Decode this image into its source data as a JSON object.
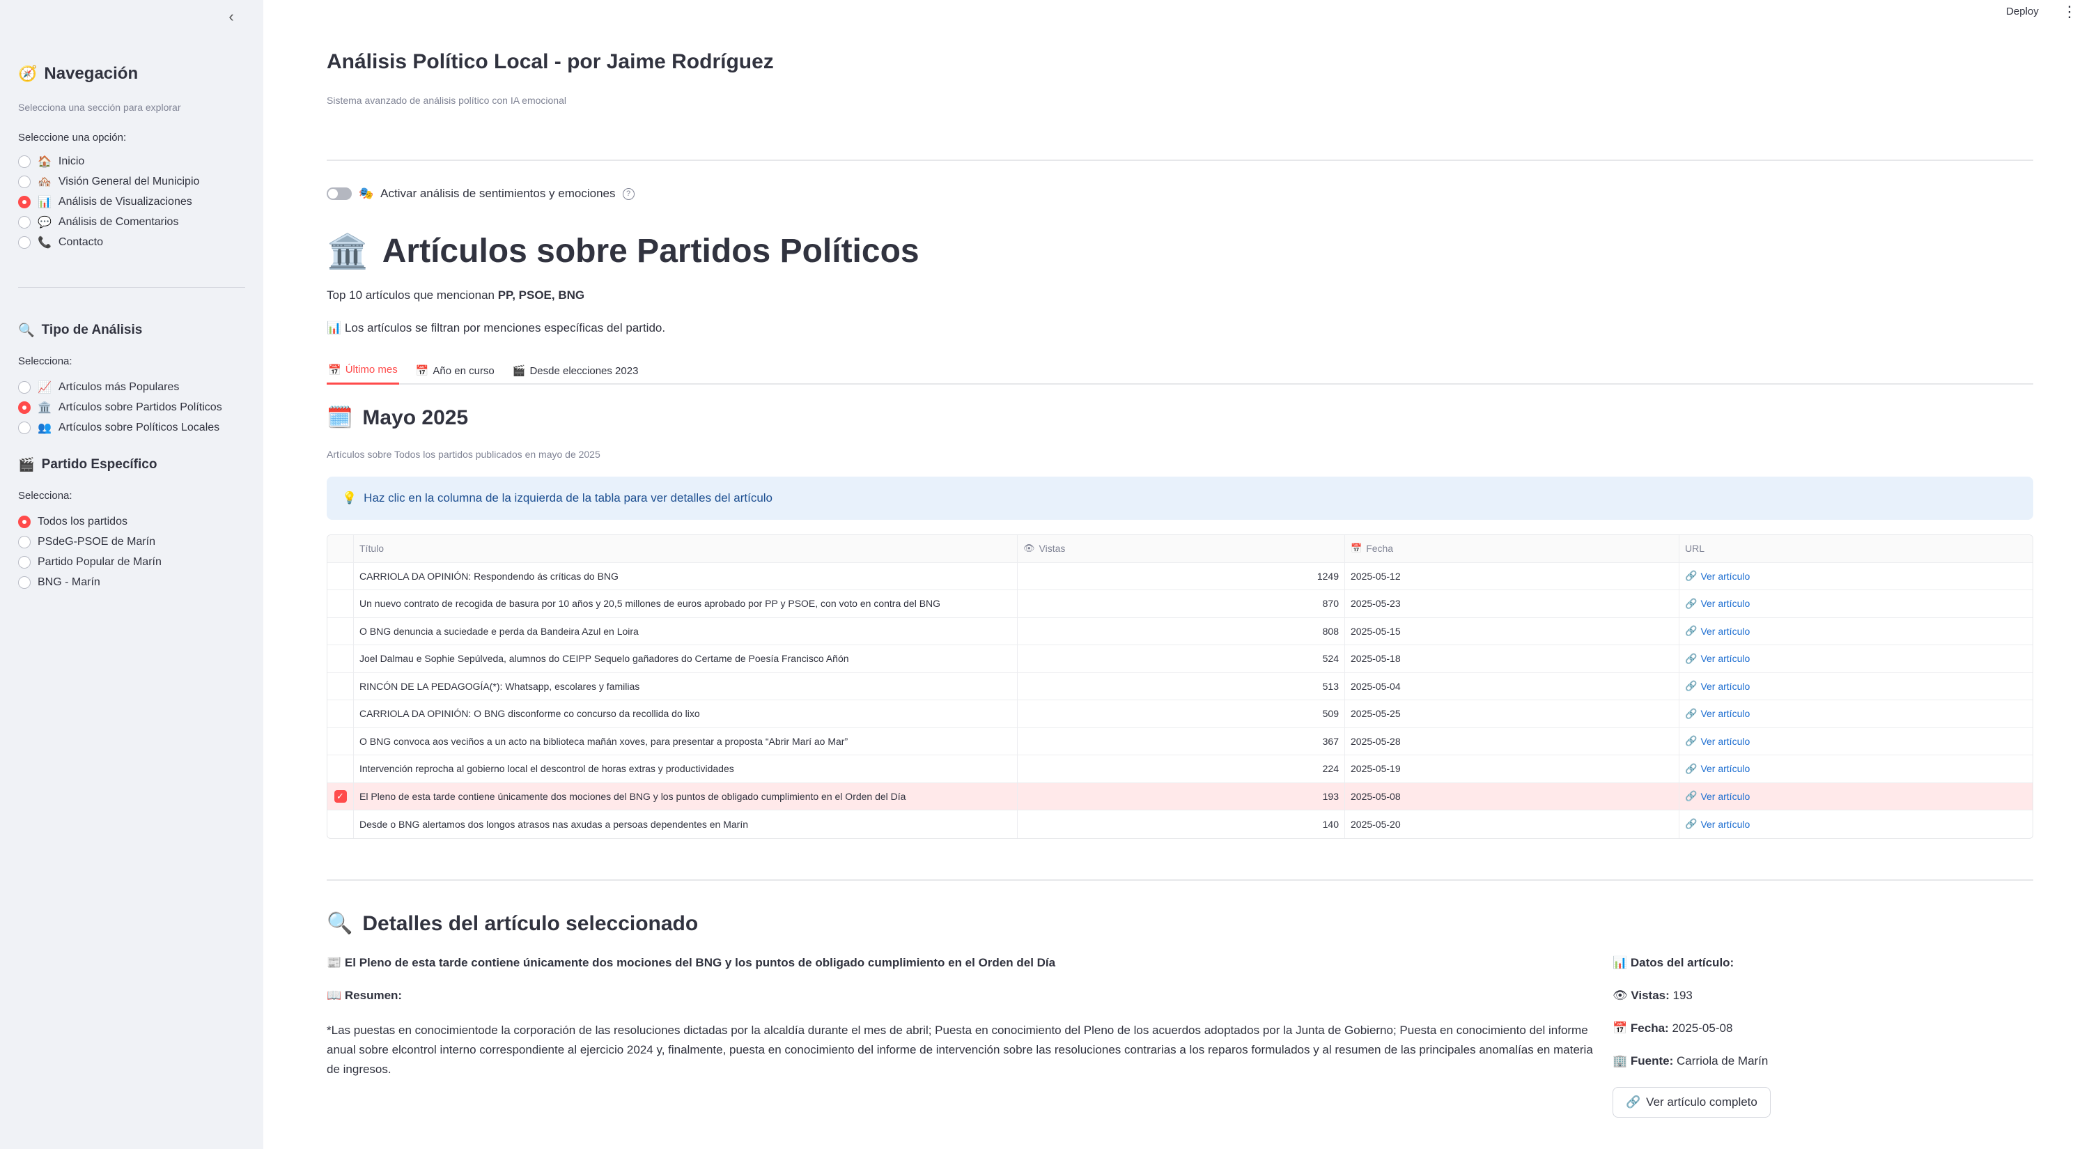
{
  "sidebar": {
    "collapse_icon": "‹",
    "nav": {
      "emoji": "🧭",
      "title": "Navegación",
      "caption": "Selecciona una sección para explorar",
      "label": "Seleccione una opción:",
      "items": [
        {
          "emoji": "🏠",
          "label": "Inicio",
          "selected": false
        },
        {
          "emoji": "🏘️",
          "label": "Visión General del Municipio",
          "selected": false
        },
        {
          "emoji": "📊",
          "label": "Análisis de Visualizaciones",
          "selected": true
        },
        {
          "emoji": "💬",
          "label": "Análisis de Comentarios",
          "selected": false
        },
        {
          "emoji": "📞",
          "label": "Contacto",
          "selected": false
        }
      ]
    },
    "analysis": {
      "emoji": "🔍",
      "title": "Tipo de Análisis",
      "label": "Selecciona:",
      "items": [
        {
          "emoji": "📈",
          "label": "Artículos más Populares",
          "selected": false
        },
        {
          "emoji": "🏛️",
          "label": "Artículos sobre Partidos Políticos",
          "selected": true
        },
        {
          "emoji": "👥",
          "label": "Artículos sobre Políticos Locales",
          "selected": false
        }
      ]
    },
    "party": {
      "emoji": "🎬",
      "title": "Partido Específico",
      "label": "Selecciona:",
      "items": [
        {
          "label": "Todos los partidos",
          "selected": true
        },
        {
          "label": "PSdeG-PSOE de Marín",
          "selected": false
        },
        {
          "label": "Partido Popular de Marín",
          "selected": false
        },
        {
          "label": "BNG - Marín",
          "selected": false
        }
      ]
    }
  },
  "toolbar": {
    "deploy_label": "Deploy",
    "menu_icon": "⋮"
  },
  "header": {
    "title": "Análisis Político Local - por Jaime Rodríguez",
    "caption": "Sistema avanzado de análisis político con IA emocional"
  },
  "toggle": {
    "emoji": "🎭",
    "label": "Activar análisis de sentimientos y emociones",
    "help_icon": "?"
  },
  "section": {
    "emoji": "🏛️",
    "title": "Artículos sobre Partidos Políticos",
    "top_prefix": "Top 10 artículos que mencionan ",
    "top_parties": "PP, PSOE, BNG",
    "filter_emoji": "📊",
    "filter_note": "Los artículos se filtran por menciones específicas del partido."
  },
  "tabs": [
    {
      "emoji": "📅",
      "label": "Último mes",
      "active": true
    },
    {
      "emoji": "📅",
      "label": "Año en curso",
      "active": false
    },
    {
      "emoji": "🎬",
      "label": "Desde elecciones 2023",
      "active": false
    }
  ],
  "month": {
    "emoji": "🗓️",
    "title": "Mayo 2025",
    "caption": "Artículos sobre Todos los partidos publicados en mayo de 2025",
    "info_emoji": "💡",
    "info": "Haz clic en la columna de la izquierda de la tabla para ver detalles del artículo"
  },
  "table": {
    "headers": {
      "title": "Título",
      "views_icon": "👁",
      "views": "Vistas",
      "date_icon": "📅",
      "date": "Fecha",
      "url": "URL"
    },
    "link_icon": "🔗",
    "check_icon": "✓",
    "rows": [
      {
        "title": "CARRIOLA DA OPINIÓN: Respondendo ás críticas do BNG",
        "views": "1249",
        "date": "2025-05-12",
        "url": "Ver artículo",
        "selected": false
      },
      {
        "title": "Un nuevo contrato de recogida de basura por 10 años y 20,5 millones de euros aprobado por PP y PSOE, con  voto en contra del BNG",
        "views": "870",
        "date": "2025-05-23",
        "url": "Ver artículo",
        "selected": false
      },
      {
        "title": "O BNG denuncia a suciedade e perda da Bandeira Azul en Loira",
        "views": "808",
        "date": "2025-05-15",
        "url": "Ver artículo",
        "selected": false
      },
      {
        "title": "Joel Dalmau e Sophie Sepúlveda, alumnos do CEIPP Sequelo gañadores do Certame de Poesía Francisco Añón",
        "views": "524",
        "date": "2025-05-18",
        "url": "Ver artículo",
        "selected": false
      },
      {
        "title": "RINCÓN DE LA PEDAGOGÍA(*): Whatsapp, escolares y familias",
        "views": "513",
        "date": "2025-05-04",
        "url": "Ver artículo",
        "selected": false
      },
      {
        "title": "CARRIOLA DA OPINIÓN: O BNG disconforme co concurso da recollida do lixo",
        "views": "509",
        "date": "2025-05-25",
        "url": "Ver artículo",
        "selected": false
      },
      {
        "title": "O BNG convoca aos veciños a un acto na biblioteca mañán xoves, para presentar a proposta “Abrir Marí ao Mar”",
        "views": "367",
        "date": "2025-05-28",
        "url": "Ver artículo",
        "selected": false
      },
      {
        "title": "Intervención reprocha al gobierno local el descontrol de horas extras y productividades",
        "views": "224",
        "date": "2025-05-19",
        "url": "Ver artículo",
        "selected": false
      },
      {
        "title": "El Pleno de esta tarde  contiene únicamente dos mociones del BNG y los puntos de obligado cumplimiento en el Orden del Día",
        "views": "193",
        "date": "2025-05-08",
        "url": "Ver artículo",
        "selected": true
      },
      {
        "title": "Desde o BNG alertamos dos longos atrasos nas axudas a persoas dependentes en Marín",
        "views": "140",
        "date": "2025-05-20",
        "url": "Ver artículo",
        "selected": false
      }
    ]
  },
  "details": {
    "emoji": "🔍",
    "title": "Detalles del artículo seleccionado",
    "article_emoji": "📰",
    "article_title": "El Pleno de esta tarde contiene únicamente dos mociones del BNG y los puntos de obligado cumplimiento en el Orden del Día",
    "summary_emoji": "📖",
    "summary_label": "Resumen:",
    "summary_text": "*Las puestas en conocimientode la corporación de las resoluciones dictadas por la alcaldía durante el mes de abril; Puesta en conocimiento del Pleno de los acuerdos adoptados por la Junta de Gobierno; Puesta en conocimiento del informe anual sobre elcontrol interno correspondiente al ejercicio 2024 y, finalmente, puesta en conocimiento del informe de intervención sobre las resoluciones contrarias  a los reparos formulados  y al resumen de las principales anomalías en materia de ingresos.",
    "data_emoji": "📊",
    "data_label": "Datos del artículo:",
    "views_emoji": "👁",
    "views_label": "Vistas:",
    "views_value": "193",
    "date_emoji": "📅",
    "date_label": "Fecha:",
    "date_value": "2025-05-08",
    "source_emoji": "🏢",
    "source_label": "Fuente:",
    "source_value": "Carriola de Marín",
    "button_emoji": "🔗",
    "button_label": "Ver artículo completo"
  },
  "colors": {
    "accent": "#ff4b4b",
    "link": "#1c6dd0",
    "info_bg": "#e8f1fb",
    "sidebar_bg": "#f0f2f6"
  }
}
